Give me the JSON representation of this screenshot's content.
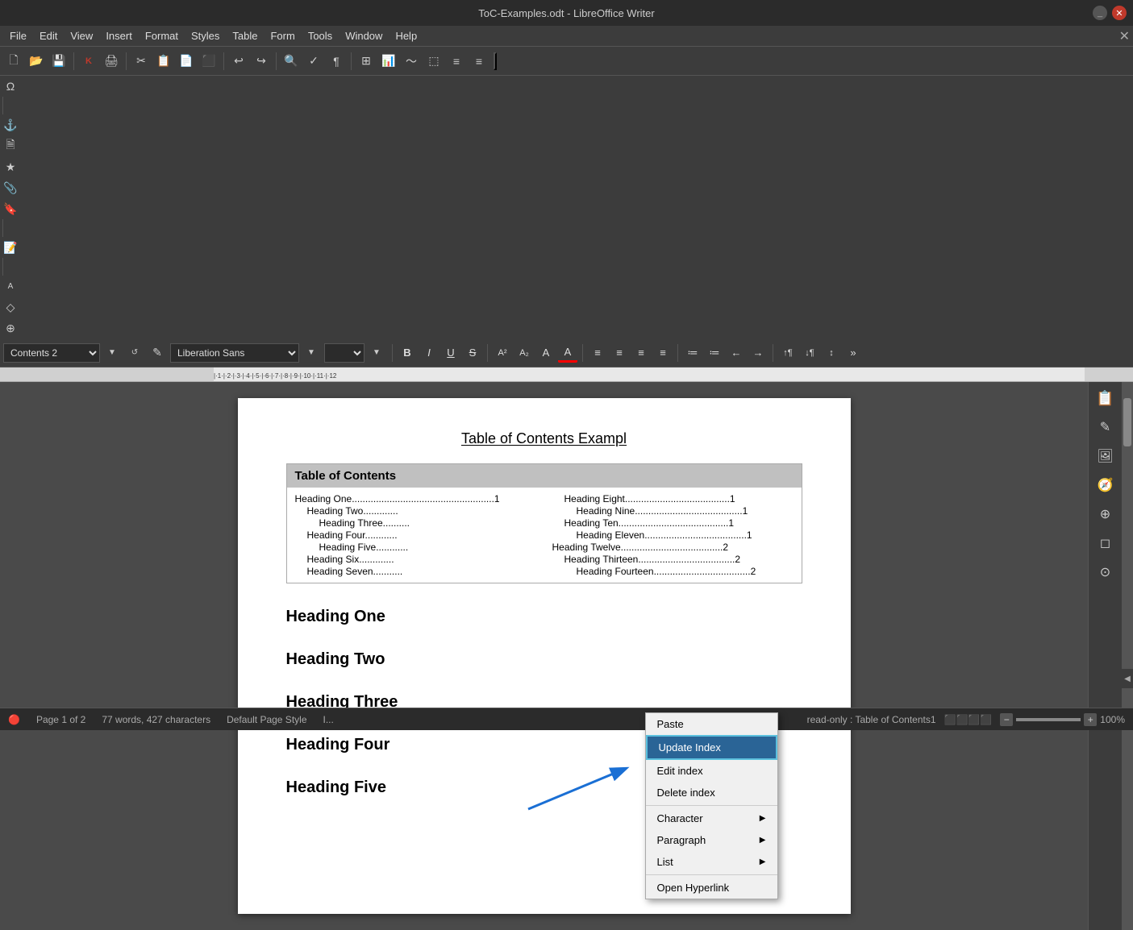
{
  "titlebar": {
    "title": "ToC-Examples.odt - LibreOffice Writer"
  },
  "menu": {
    "items": [
      "File",
      "Edit",
      "View",
      "Insert",
      "Format",
      "Styles",
      "Table",
      "Form",
      "Tools",
      "Window",
      "Help"
    ]
  },
  "toolbar1": {
    "buttons": [
      "🗋",
      "📂",
      "💾",
      "✉",
      "✂",
      "📋",
      "↩",
      "↪",
      "🔍",
      "✏",
      "Ω",
      "🔗",
      "📌",
      "⭐",
      "📎",
      "🔖",
      "📝",
      "A"
    ]
  },
  "toolbar2": {
    "style": "Contents 2",
    "font": "Liberation Sans",
    "size": "",
    "buttons": [
      "B",
      "I",
      "U",
      "S",
      "A↑",
      "A↓",
      "A",
      "A"
    ]
  },
  "document": {
    "title": "Table of Contents Exampl",
    "toc_header": "Table of Contents",
    "toc_left": [
      {
        "text": "Heading One.....................................................1",
        "indent": 0
      },
      {
        "text": "Heading Two.............",
        "indent": 1
      },
      {
        "text": "Heading Three..........",
        "indent": 2
      },
      {
        "text": "Heading Four............",
        "indent": 1
      },
      {
        "text": "Heading Five............",
        "indent": 2
      },
      {
        "text": "Heading Six.............",
        "indent": 1
      },
      {
        "text": "Heading Seven...........",
        "indent": 1
      }
    ],
    "toc_right": [
      {
        "text": "Heading Eight.......................................1",
        "indent": 1
      },
      {
        "text": "Heading Nine........................................1",
        "indent": 2
      },
      {
        "text": "Heading Ten.........................................1",
        "indent": 1
      },
      {
        "text": "Heading Eleven......................................1",
        "indent": 2
      },
      {
        "text": "Heading Twelve......................................2",
        "indent": 0
      },
      {
        "text": "Heading Thirteen....................................2",
        "indent": 1
      },
      {
        "text": "Heading Fourteen....................................2",
        "indent": 2
      }
    ],
    "headings": [
      "Heading One",
      "Heading Two",
      "Heading Three",
      "Heading Four",
      "Heading Five"
    ]
  },
  "context_menu": {
    "items": [
      {
        "label": "Paste",
        "shortcut": "",
        "has_submenu": false,
        "highlighted": false
      },
      {
        "label": "Update Index",
        "shortcut": "",
        "has_submenu": false,
        "highlighted": true
      },
      {
        "label": "Edit index",
        "shortcut": "",
        "has_submenu": false,
        "highlighted": false
      },
      {
        "label": "Delete index",
        "shortcut": "",
        "has_submenu": false,
        "highlighted": false
      },
      {
        "label": "Character",
        "shortcut": "",
        "has_submenu": true,
        "highlighted": false
      },
      {
        "label": "Paragraph",
        "shortcut": "",
        "has_submenu": true,
        "highlighted": false
      },
      {
        "label": "List",
        "shortcut": "",
        "has_submenu": true,
        "highlighted": false
      },
      {
        "label": "Open Hyperlink",
        "shortcut": "",
        "has_submenu": false,
        "highlighted": false
      }
    ]
  },
  "status_bar": {
    "page": "Page 1 of 2",
    "words": "77 words, 427 characters",
    "page_style": "Default Page Style",
    "cursor": "I...",
    "readonly": "read-only : Table of Contents1",
    "zoom": "100%"
  }
}
